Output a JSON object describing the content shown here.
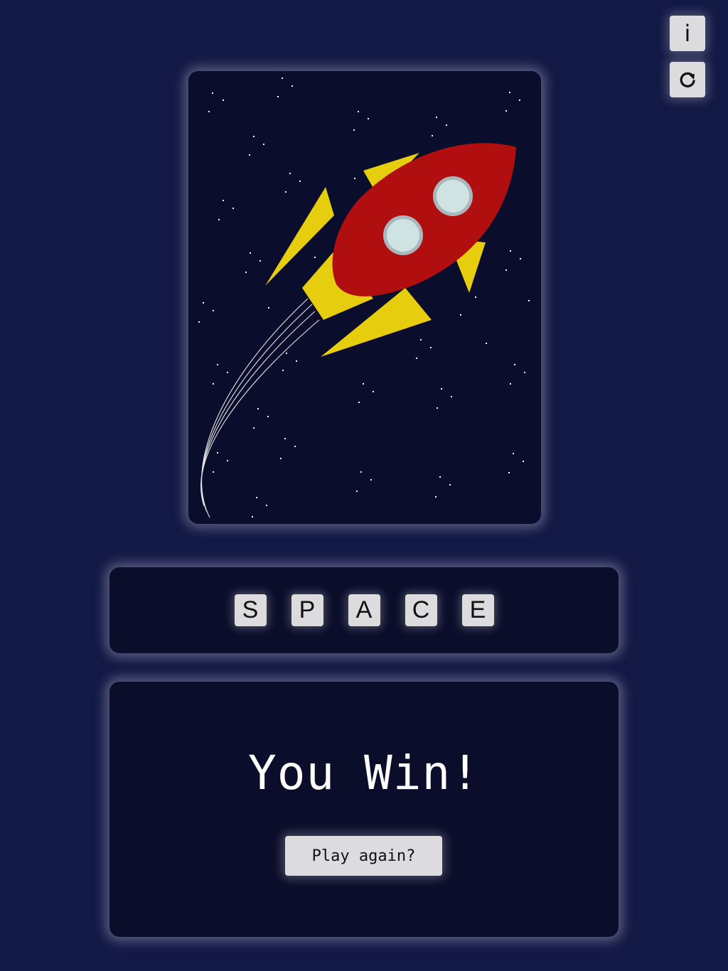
{
  "controls": {
    "info_label": "i",
    "info_icon": "info-icon",
    "reset_icon": "refresh-icon"
  },
  "picture": {
    "subject": "rocket",
    "colors": {
      "sky": "#0a0d2b",
      "body": "#b10f0f",
      "fins": "#e6cd0d",
      "windows": "#cfe3e3",
      "trail": "#ffffff"
    }
  },
  "word": {
    "letters": [
      "S",
      "P",
      "A",
      "C",
      "E"
    ]
  },
  "result": {
    "title": "You Win!",
    "play_again_label": "Play again?"
  }
}
